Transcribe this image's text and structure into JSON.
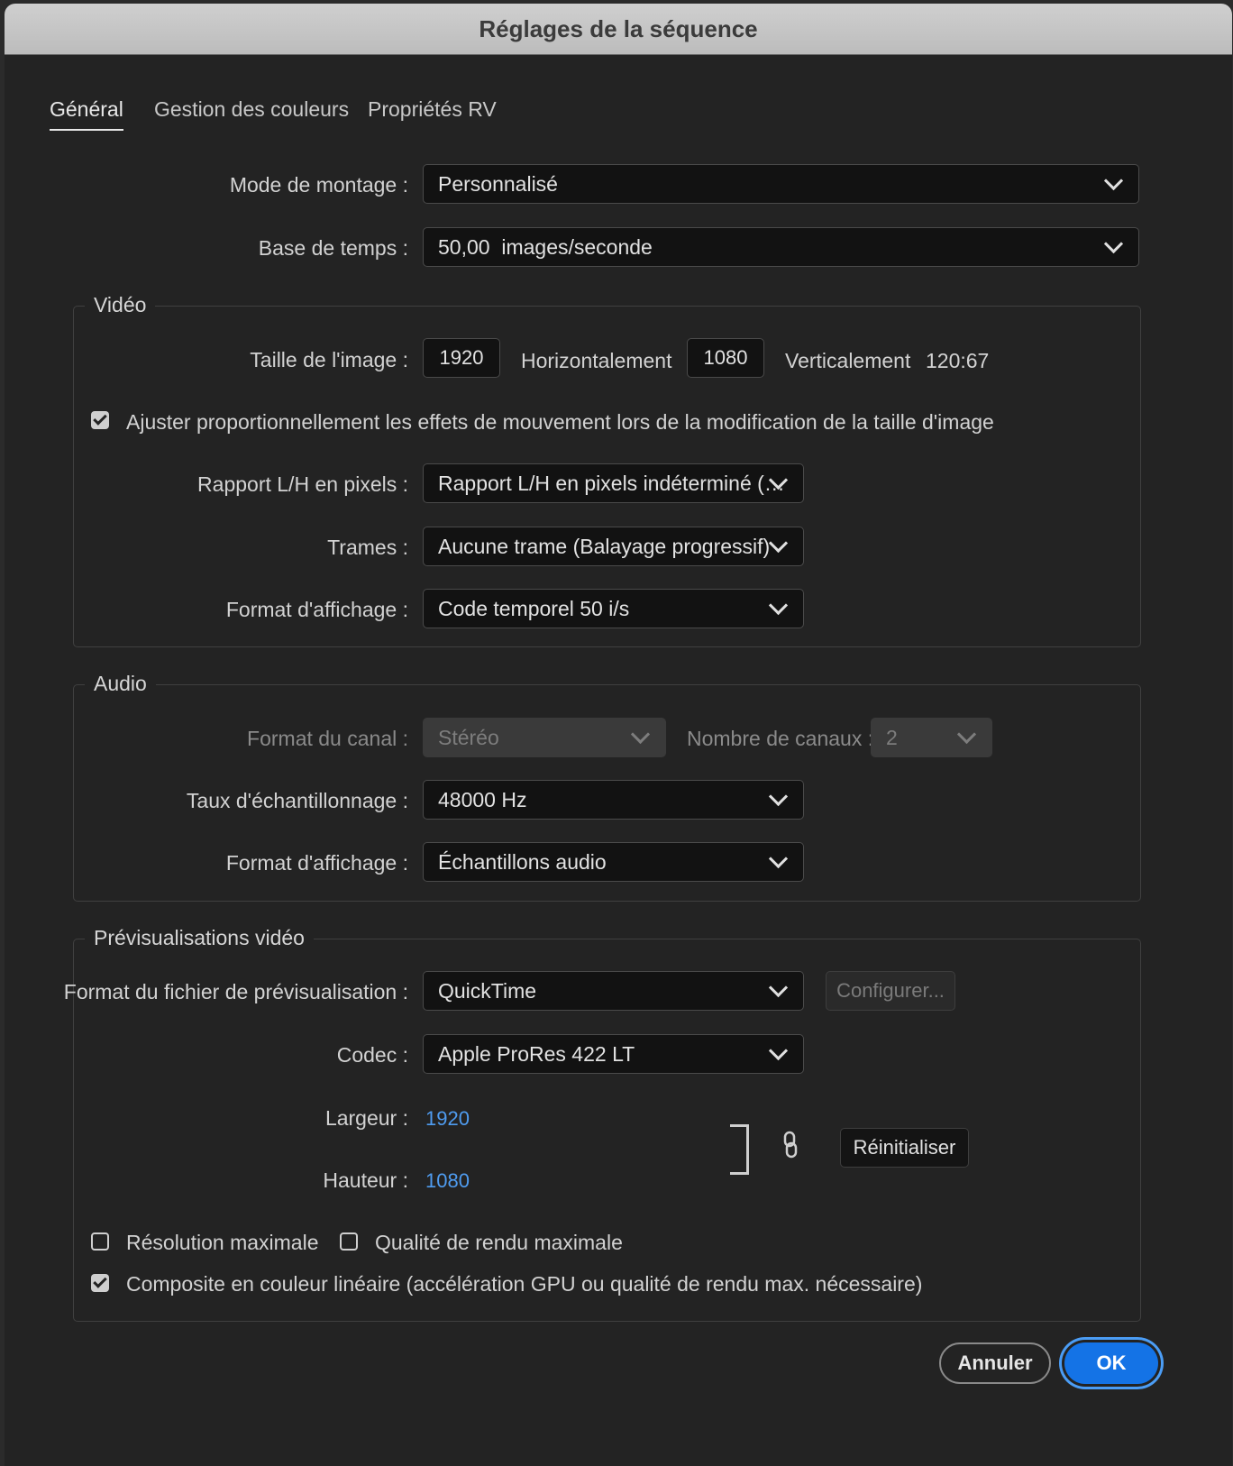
{
  "window": {
    "title": "Réglages de la séquence"
  },
  "tabs": [
    {
      "label": "Général",
      "active": true
    },
    {
      "label": "Gestion des couleurs",
      "active": false
    },
    {
      "label": "Propriétés RV",
      "active": false
    }
  ],
  "general": {
    "editing_mode_label": "Mode de montage :",
    "editing_mode_value": "Personnalisé",
    "timebase_label": "Base de temps :",
    "timebase_value": "50,00  images/seconde"
  },
  "video": {
    "title": "Vidéo",
    "frame_size_label": "Taille de l'image :",
    "width": "1920",
    "horizontal_label": "Horizontalement",
    "height": "1080",
    "vertical_label": "Verticalement",
    "aspect": "120:67",
    "scale_checkbox_label": "Ajuster proportionnellement les effets de mouvement lors de la modification de la taille d'image",
    "scale_checkbox_checked": true,
    "pixel_aspect_label": "Rapport L/H en pixels :",
    "pixel_aspect_value": "Rapport L/H en pixels indéterminé (…",
    "fields_label": "Trames :",
    "fields_value": "Aucune trame (Balayage progressif)",
    "display_format_label": "Format d'affichage :",
    "display_format_value": "Code temporel 50 i/s"
  },
  "audio": {
    "title": "Audio",
    "channel_format_label": "Format du canal :",
    "channel_format_value": "Stéréo",
    "channel_count_label": "Nombre de canaux :",
    "channel_count_value": "2",
    "sample_rate_label": "Taux d'échantillonnage :",
    "sample_rate_value": "48000 Hz",
    "display_format_label": "Format d'affichage :",
    "display_format_value": "Échantillons audio"
  },
  "previews": {
    "title": "Prévisualisations vidéo",
    "file_format_label": "Format du fichier de prévisualisation :",
    "file_format_value": "QuickTime",
    "configure_label": "Configurer...",
    "codec_label": "Codec :",
    "codec_value": "Apple ProRes 422 LT",
    "width_label": "Largeur :",
    "width_value": "1920",
    "height_label": "Hauteur :",
    "height_value": "1080",
    "reset_label": "Réinitialiser",
    "max_res_label": "Résolution maximale",
    "max_res_checked": false,
    "max_quality_label": "Qualité de rendu maximale",
    "max_quality_checked": false,
    "linear_label": "Composite en couleur linéaire (accélération GPU ou qualité de rendu max. nécessaire)",
    "linear_checked": true
  },
  "footer": {
    "cancel_label": "Annuler",
    "ok_label": "OK"
  },
  "colors": {
    "accent": "#1473e6",
    "link": "#4f9cf0"
  }
}
